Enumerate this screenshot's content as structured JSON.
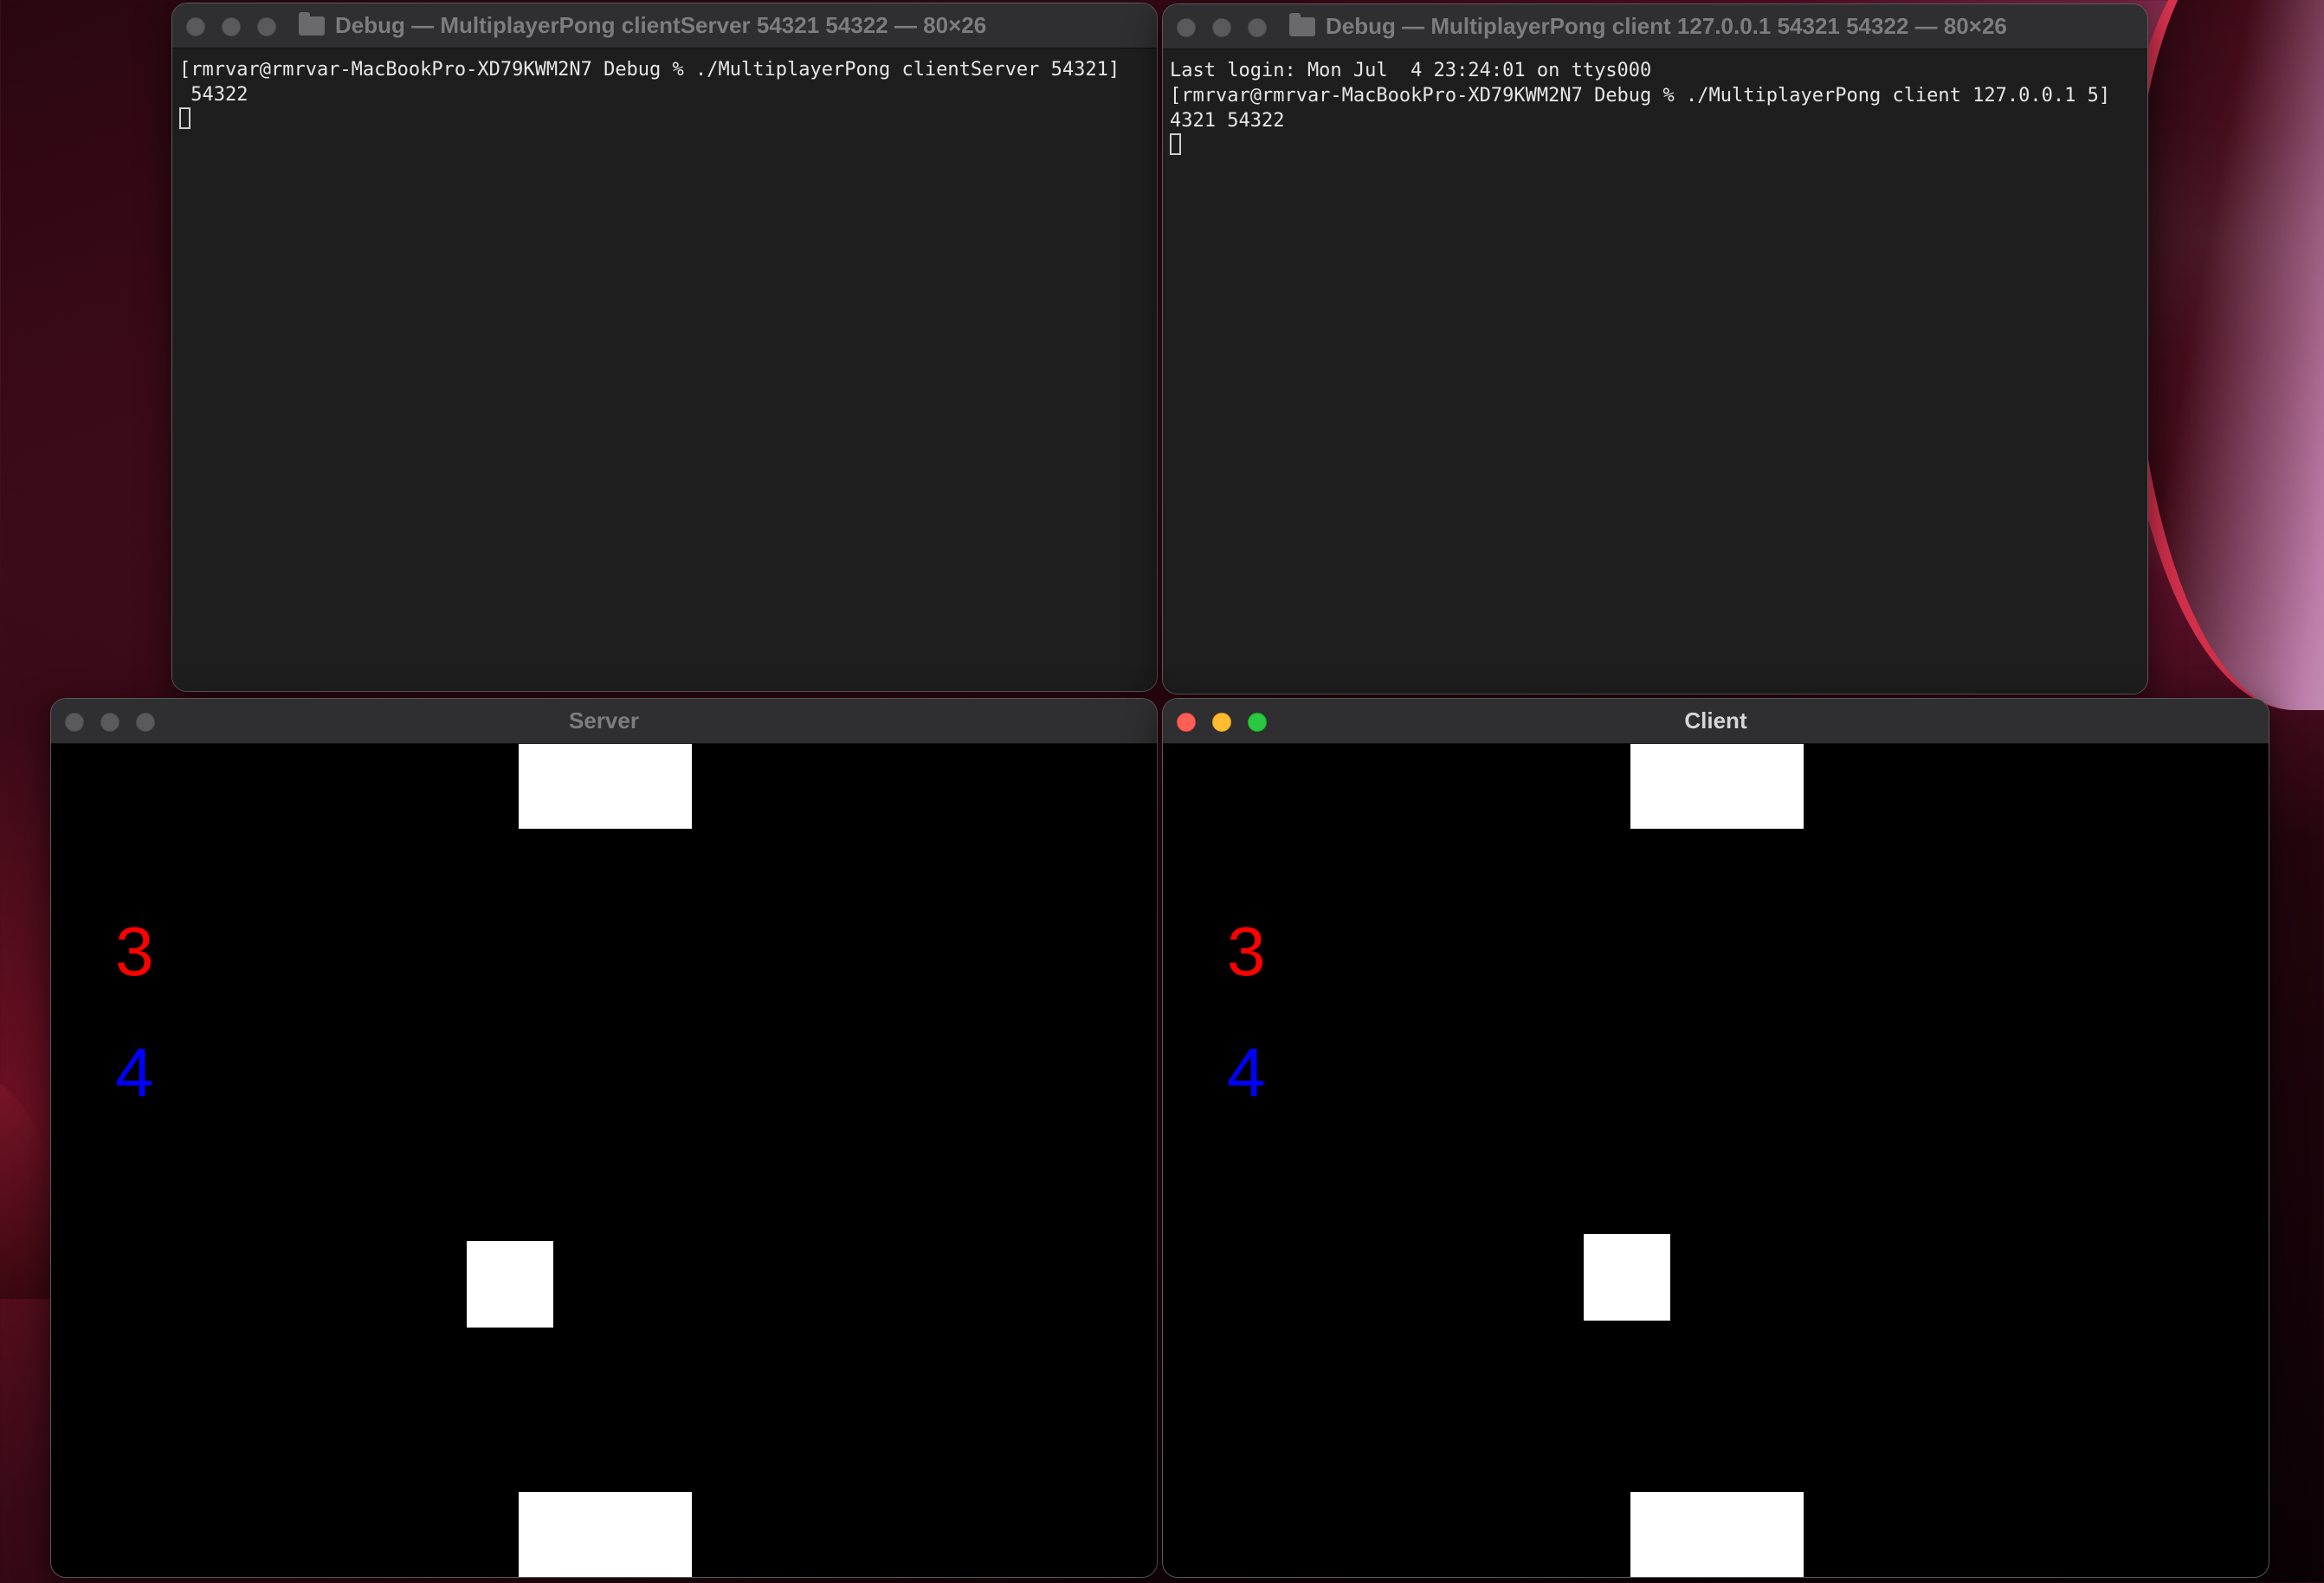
{
  "colors": {
    "terminal_bg": "#1e1e1e",
    "game_bg": "#000000",
    "score_red": "#ff0000",
    "score_blue": "#0000ff",
    "traffic_close": "#ff5f57",
    "traffic_minimize": "#febc2e",
    "traffic_maximize": "#28c840"
  },
  "terminal_server": {
    "title": "Debug — MultiplayerPong clientServer 54321 54322 — 80×26",
    "lines": [
      "[rmrvar@rmrvar-MacBookPro-XD79KWM2N7 Debug % ./MultiplayerPong clientServer 54321]",
      " 54322"
    ]
  },
  "terminal_client": {
    "title": "Debug — MultiplayerPong client 127.0.0.1 54321 54322 — 80×26",
    "lines": [
      "Last login: Mon Jul  4 23:24:01 on ttys000",
      "[rmrvar@rmrvar-MacBookPro-XD79KWM2N7 Debug % ./MultiplayerPong client 127.0.0.1 5]",
      "4321 54322"
    ]
  },
  "game_server": {
    "title": "Server",
    "score_red": "3",
    "score_blue": "4"
  },
  "game_client": {
    "title": "Client",
    "score_red": "3",
    "score_blue": "4"
  }
}
